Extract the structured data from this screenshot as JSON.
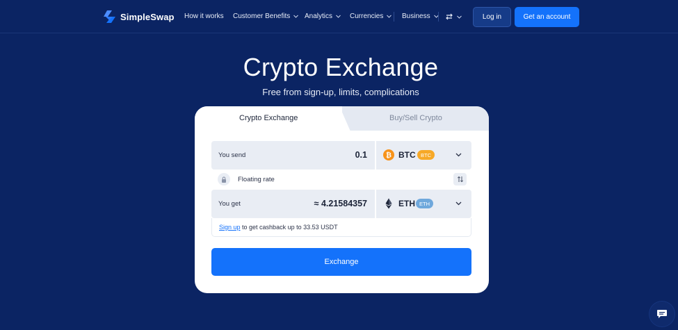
{
  "nav": {
    "brand": "SimpleSwap",
    "items": [
      {
        "label": "How it works",
        "dropdown": false
      },
      {
        "label": "Customer Benefits",
        "dropdown": true
      },
      {
        "label": "Analytics",
        "dropdown": true
      },
      {
        "label": "Currencies",
        "dropdown": true
      },
      {
        "label": "Business",
        "dropdown": true
      }
    ],
    "login_label": "Log in",
    "account_label": "Get an account"
  },
  "hero": {
    "title": "Crypto Exchange",
    "subtitle": "Free from sign-up, limits, complications"
  },
  "widget": {
    "tabs": [
      "Crypto Exchange",
      "Buy/Sell Crypto"
    ],
    "active_tab": "Crypto Exchange",
    "send": {
      "label": "You send",
      "amount": "0.1",
      "ticker": "BTC",
      "badge": "BTC",
      "coin_color": "#f7931a",
      "badge_color": "#f7a928"
    },
    "rate_label": "Floating rate",
    "get": {
      "label": "You get",
      "amount": "≈ 4.21584357",
      "ticker": "ETH",
      "badge": "ETH",
      "badge_color": "#6fa8dc"
    },
    "cashback": {
      "link": "Sign up",
      "text": " to get cashback up to 33.53 USDT"
    },
    "exchange_label": "Exchange"
  },
  "colors": {
    "background": "#0b2463",
    "accent": "#1472fb"
  },
  "icons": [
    "logo-icon",
    "chevron-down-icon",
    "swap-arrows-icon",
    "bitcoin-icon",
    "ethereum-icon",
    "lock-icon",
    "reverse-icon",
    "chat-icon"
  ]
}
